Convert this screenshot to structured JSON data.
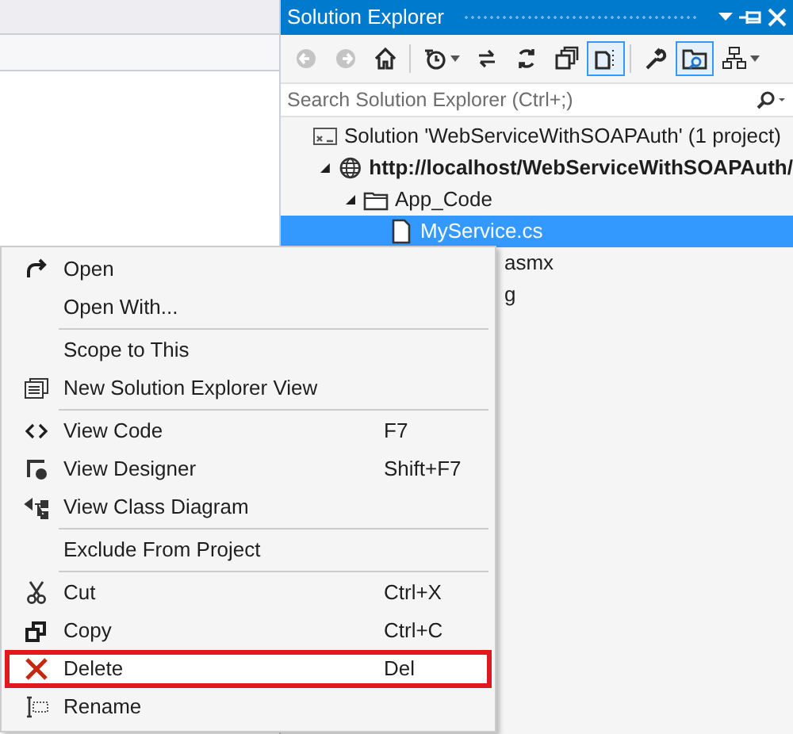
{
  "solution_explorer": {
    "title": "Solution Explorer",
    "toolbar": [
      {
        "disabled": true,
        "pressed": false
      },
      {
        "disabled": true,
        "pressed": false
      },
      {
        "disabled": false,
        "pressed": false
      },
      {
        "disabled": false,
        "pressed": false,
        "dropdown": true
      },
      {
        "disabled": false,
        "pressed": false
      },
      {
        "disabled": false,
        "pressed": false
      },
      {
        "disabled": false,
        "pressed": false
      },
      {
        "disabled": false,
        "pressed": true
      },
      {
        "disabled": false,
        "pressed": false
      },
      {
        "disabled": false,
        "pressed": true
      },
      {
        "disabled": false,
        "pressed": false,
        "dropdown": true
      }
    ],
    "search": {
      "placeholder": "Search Solution Explorer (Ctrl+;)"
    },
    "tree": [
      {
        "kind": "solution",
        "label": "Solution 'WebServiceWithSOAPAuth' (1 project)",
        "selected": false,
        "children": [
          {
            "kind": "website",
            "label": "http://localhost/WebServiceWithSOAPAuth/",
            "selected": false,
            "expanded": true,
            "children": [
              {
                "kind": "folder",
                "label": "App_Code",
                "selected": false,
                "expanded": true,
                "children": [
                  {
                    "kind": "file",
                    "label": "MyService.cs",
                    "selected": true
                  }
                ]
              },
              {
                "kind": "clipped",
                "label": "asmx",
                "selected": false
              },
              {
                "kind": "clipped",
                "label": "g",
                "selected": false
              }
            ]
          }
        ]
      }
    ]
  },
  "context_menu": {
    "groups": [
      [
        {
          "label": "Open",
          "highlighted": false
        },
        {
          "label": "Open With...",
          "highlighted": false
        }
      ],
      [
        {
          "label": "Scope to This",
          "highlighted": false
        },
        {
          "label": "New Solution Explorer View",
          "highlighted": false
        }
      ],
      [
        {
          "label": "View Code",
          "shortcut": "F7",
          "highlighted": false
        },
        {
          "label": "View Designer",
          "shortcut": "Shift+F7",
          "highlighted": false
        },
        {
          "label": "View Class Diagram",
          "highlighted": false
        }
      ],
      [
        {
          "label": "Exclude From Project",
          "highlighted": false
        }
      ],
      [
        {
          "label": "Cut",
          "shortcut": "Ctrl+X",
          "highlighted": false
        },
        {
          "label": "Copy",
          "shortcut": "Ctrl+C",
          "highlighted": false
        },
        {
          "label": "Delete",
          "shortcut": "Del",
          "highlighted": true
        },
        {
          "label": "Rename",
          "highlighted": false
        }
      ]
    ]
  }
}
